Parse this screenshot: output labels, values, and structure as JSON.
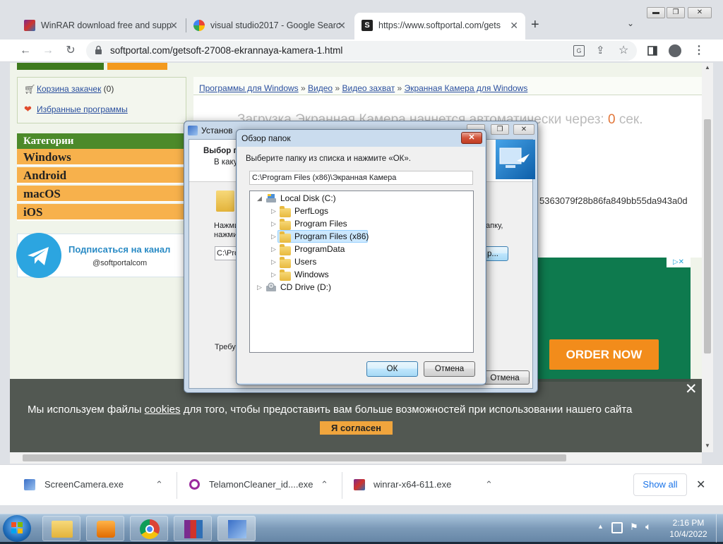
{
  "browser": {
    "tabs": [
      {
        "title": "WinRAR download free and supp",
        "favicon": "winrar-icon"
      },
      {
        "title": "visual studio2017 - Google Searc",
        "favicon": "google-icon"
      },
      {
        "title": "https://www.softportal.com/gets",
        "favicon": "softportal-icon"
      }
    ],
    "new_tab": "+",
    "url": "softportal.com/getsoft-27008-ekrannaya-kamera-1.html"
  },
  "page": {
    "cart_label": "Корзина закачек",
    "cart_count": "(0)",
    "favorites_label": "Избранные программы",
    "breadcrumb": [
      "Программы для Windows",
      "Видео",
      "Видео захват",
      "Экранная Камера для Windows"
    ],
    "breadcrumb_sep": "»",
    "download_msg": "Загрузка Экранная Камера начнется автоматически через:",
    "download_count": "0",
    "download_unit": "сек.",
    "categories_title": "Категории",
    "categories": [
      "Windows",
      "Android",
      "macOS",
      "iOS"
    ],
    "telegram_title": "Подписаться на канал",
    "telegram_handle": "@softportalcom",
    "hash_text": "5363079f28b86fa849bb55da943a0d",
    "ad_button": "ORDER NOW"
  },
  "installer": {
    "title": "Установ",
    "heading": "Выбор п",
    "subtext": "В каку",
    "body1": "Нажми",
    "body2": "нажми",
    "body_right": "апку,",
    "path_value": "C:\\Prog",
    "browse_label": "р...",
    "required": "Требуе",
    "cancel": "Отмена"
  },
  "browse_dialog": {
    "title": "Обзор папок",
    "instruction": "Выберите папку из списка и нажмите «ОК».",
    "path": "C:\\Program Files (x86)\\Экранная Камера",
    "tree": [
      {
        "label": "Local Disk (C:)",
        "level": 0,
        "expanded": true,
        "icon": "hard-drive-icon"
      },
      {
        "label": "PerfLogs",
        "level": 1,
        "icon": "folder-icon"
      },
      {
        "label": "Program Files",
        "level": 1,
        "icon": "folder-icon"
      },
      {
        "label": "Program Files (x86)",
        "level": 1,
        "icon": "folder-icon",
        "selected": true
      },
      {
        "label": "ProgramData",
        "level": 1,
        "icon": "folder-icon"
      },
      {
        "label": "Users",
        "level": 1,
        "icon": "folder-icon"
      },
      {
        "label": "Windows",
        "level": 1,
        "icon": "folder-icon"
      },
      {
        "label": "CD Drive (D:)",
        "level": 0,
        "icon": "cd-drive-icon"
      }
    ],
    "ok": "ОК",
    "cancel": "Отмена"
  },
  "cookie": {
    "text_before": "Мы используем файлы",
    "link": "cookies",
    "text_after": "для того, чтобы предоставить вам больше возможностей при использовании нашего сайта",
    "accept": "Я согласен"
  },
  "downloads": {
    "items": [
      {
        "name": "ScreenCamera.exe",
        "icon": "screencamera-icon"
      },
      {
        "name": "TelamonCleaner_id....exe",
        "icon": "telamon-icon"
      },
      {
        "name": "winrar-x64-611.exe",
        "icon": "winrar-icon"
      }
    ],
    "show_all": "Show all"
  },
  "taskbar": {
    "time": "2:16 PM",
    "date": "10/4/2022"
  },
  "colors": {
    "accent_orange": "#f7b14c",
    "ad_green": "#0e7a4e",
    "ad_orange": "#f28c1b",
    "selection": "#cce8ff"
  }
}
